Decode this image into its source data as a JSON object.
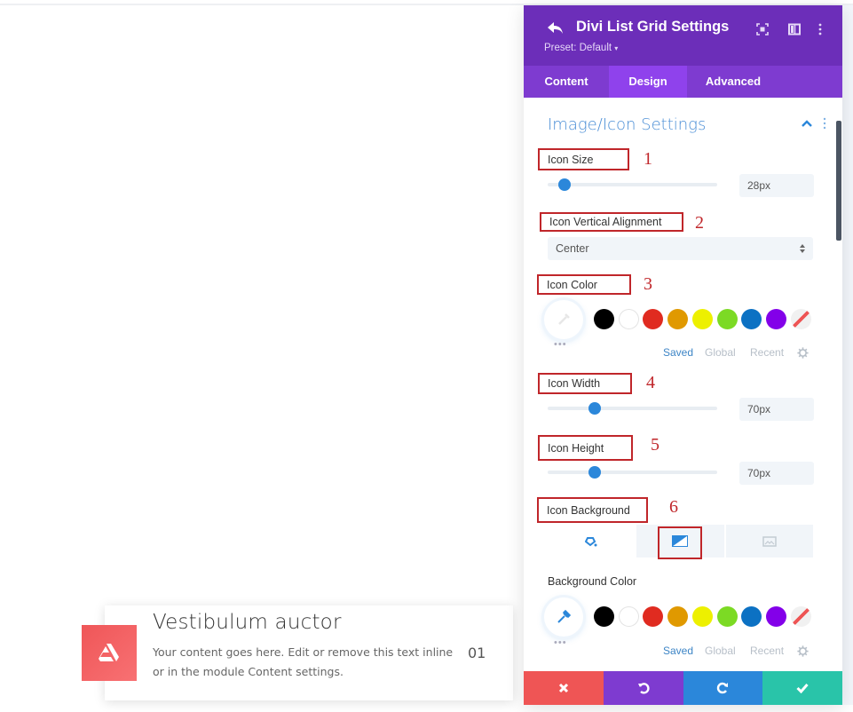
{
  "preview": {
    "title": "Vestibulum auctor",
    "text": "Your content goes here. Edit or remove this text inline or in the module Content settings.",
    "number": "01",
    "icon": "artstation-logo-icon",
    "icon_gradient": [
      "#ef5658",
      "#f87173"
    ]
  },
  "panel": {
    "title": "Divi List Grid Settings",
    "preset": "Preset: Default",
    "header_color": "#6c2eb9",
    "tabs": [
      {
        "label": "Content",
        "active": false
      },
      {
        "label": "Design",
        "active": true
      },
      {
        "label": "Advanced",
        "active": false
      }
    ],
    "header_icons": [
      "back-arrow-icon",
      "focus-icon",
      "split-view-icon",
      "more-vertical-icon"
    ],
    "section": {
      "title": "Image/Icon Settings",
      "expanded": true
    },
    "fields": {
      "icon_size": {
        "label": "Icon Size",
        "value": "28px",
        "slider_fraction": 0.1,
        "annotation": "1"
      },
      "icon_vertical_alignment": {
        "label": "Icon Vertical Alignment",
        "value": "Center",
        "annotation": "2"
      },
      "icon_color": {
        "label": "Icon Color",
        "annotation": "3"
      },
      "icon_width": {
        "label": "Icon Width",
        "value": "70px",
        "slider_fraction": 0.28,
        "annotation": "4"
      },
      "icon_height": {
        "label": "Icon Height",
        "value": "70px",
        "slider_fraction": 0.28,
        "annotation": "5"
      },
      "icon_background": {
        "label": "Icon Background",
        "annotation": "6",
        "tabs": [
          "color-fill-icon",
          "gradient-icon",
          "image-icon"
        ],
        "active_tab": 1
      },
      "background_color": {
        "label": "Background Color"
      }
    },
    "palette": [
      "#000000",
      "#ffffff",
      "#e02b20",
      "#e09900",
      "#edf000",
      "#7cda24",
      "#0c71c3",
      "#8300e9",
      "none"
    ],
    "color_tabs": {
      "saved": "Saved",
      "global": "Global",
      "recent": "Recent"
    },
    "footer": [
      {
        "name": "cancel",
        "icon": "close-icon",
        "color": "#ef5555"
      },
      {
        "name": "undo",
        "icon": "undo-icon",
        "color": "#7e3bd0"
      },
      {
        "name": "redo",
        "icon": "redo-icon",
        "color": "#2b87da"
      },
      {
        "name": "save",
        "icon": "check-icon",
        "color": "#29c4a9"
      }
    ]
  }
}
